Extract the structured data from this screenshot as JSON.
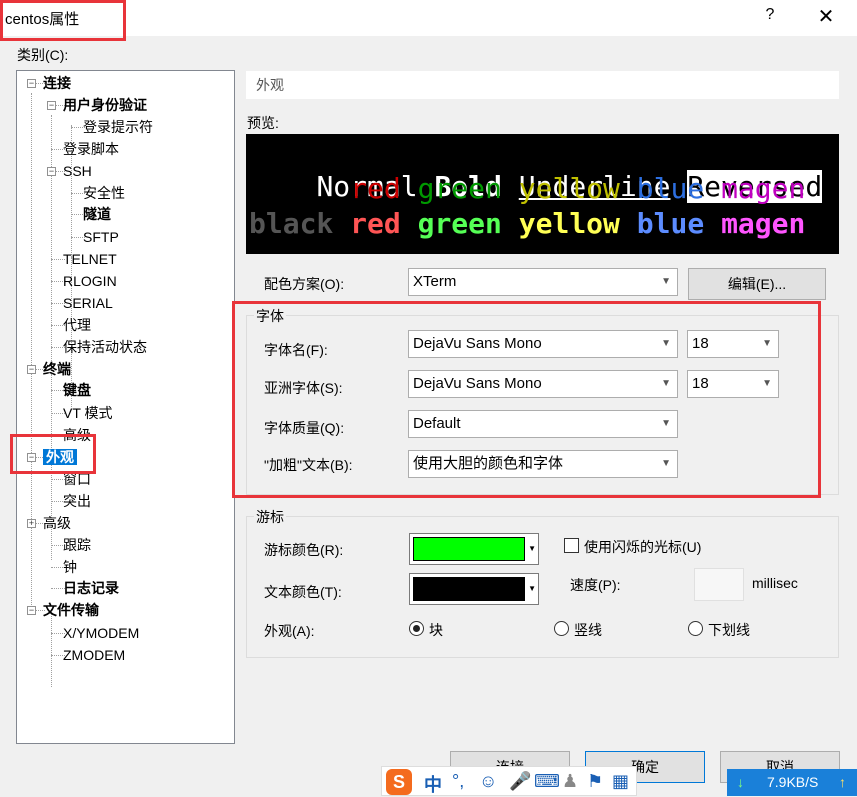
{
  "window": {
    "title": "centos属性",
    "help": "?",
    "close": "✕"
  },
  "category_label": "类别(C):",
  "tree": [
    {
      "label": "连接",
      "bold": true,
      "toggle": "−"
    },
    {
      "label": "用户身份验证",
      "bold": true,
      "toggle": "−"
    },
    {
      "label": "登录提示符",
      "bold": false,
      "toggle": ""
    },
    {
      "label": "登录脚本",
      "bold": false,
      "toggle": ""
    },
    {
      "label": "SSH",
      "bold": false,
      "toggle": "−"
    },
    {
      "label": "安全性",
      "bold": false,
      "toggle": ""
    },
    {
      "label": "隧道",
      "bold": true,
      "toggle": ""
    },
    {
      "label": "SFTP",
      "bold": false,
      "toggle": ""
    },
    {
      "label": "TELNET",
      "bold": false,
      "toggle": ""
    },
    {
      "label": "RLOGIN",
      "bold": false,
      "toggle": ""
    },
    {
      "label": "SERIAL",
      "bold": false,
      "toggle": ""
    },
    {
      "label": "代理",
      "bold": false,
      "toggle": ""
    },
    {
      "label": "保持活动状态",
      "bold": false,
      "toggle": ""
    },
    {
      "label": "终端",
      "bold": true,
      "toggle": "−"
    },
    {
      "label": "键盘",
      "bold": true,
      "toggle": ""
    },
    {
      "label": "VT 模式",
      "bold": false,
      "toggle": ""
    },
    {
      "label": "高级",
      "bold": false,
      "toggle": ""
    },
    {
      "label": "外观",
      "bold": true,
      "toggle": "−",
      "selected": true
    },
    {
      "label": "窗口",
      "bold": false,
      "toggle": ""
    },
    {
      "label": "突出",
      "bold": false,
      "toggle": ""
    },
    {
      "label": "高级",
      "bold": false,
      "toggle": "+"
    },
    {
      "label": "跟踪",
      "bold": false,
      "toggle": ""
    },
    {
      "label": "钟",
      "bold": false,
      "toggle": ""
    },
    {
      "label": "日志记录",
      "bold": true,
      "toggle": ""
    },
    {
      "label": "文件传输",
      "bold": true,
      "toggle": "−"
    },
    {
      "label": "X/YMODEM",
      "bold": false,
      "toggle": ""
    },
    {
      "label": "ZMODEM",
      "bold": false,
      "toggle": ""
    }
  ],
  "section_title": "外观",
  "preview": {
    "label": "预览:",
    "row1": {
      "normal": "Normal ",
      "bold": "Bold",
      "underline": "Underline",
      "reversed": "Reversed",
      "cursor": "C",
      "cursor_rest": "u"
    },
    "row2": {
      "words": [
        "red",
        "green",
        "yellow",
        "blue",
        "magen"
      ]
    },
    "row3": {
      "black": "black",
      "words": [
        "red",
        "green",
        "yellow",
        "blue",
        "magen"
      ]
    },
    "colors": {
      "dim": [
        "#cc0000",
        "#009900",
        "#bfbf00",
        "#2d6fe0",
        "#c000c0"
      ],
      "bright": [
        "#ff5555",
        "#55ff55",
        "#ffff55",
        "#5c8cff",
        "#ff55ff"
      ],
      "black_bright": "#555555",
      "cursor": "#00e000"
    }
  },
  "color_scheme": {
    "label": "配色方案(O):",
    "value": "XTerm",
    "edit_button": "编辑(E)..."
  },
  "font_group": {
    "title": "字体",
    "font_name_label": "字体名(F):",
    "font_name": "DejaVu Sans Mono",
    "font_size": "18",
    "asian_label": "亚洲字体(S):",
    "asian_font": "DejaVu Sans Mono",
    "asian_size": "18",
    "quality_label": "字体质量(Q):",
    "quality": "Default",
    "bold_label": "\"加粗\"文本(B):",
    "bold_value": "使用大胆的颜色和字体"
  },
  "cursor_group": {
    "title": "游标",
    "cursor_color_label": "游标颜色(R):",
    "cursor_color": "#00ff00",
    "text_color_label": "文本颜色(T):",
    "text_color": "#000000",
    "blink_label": "使用闪烁的光标(U)",
    "speed_label": "速度(P):",
    "speed_unit": "millisec",
    "appearance_label": "外观(A):",
    "opt_block": "块",
    "opt_vline": "竖线",
    "opt_underline": "下划线"
  },
  "buttons": {
    "connect": "连接",
    "ok": "确定",
    "cancel": "取消"
  },
  "ime": {
    "logo": "S",
    "lang": "中",
    "punct": "°,"
  },
  "net": {
    "speed": "7.9KB/S"
  }
}
